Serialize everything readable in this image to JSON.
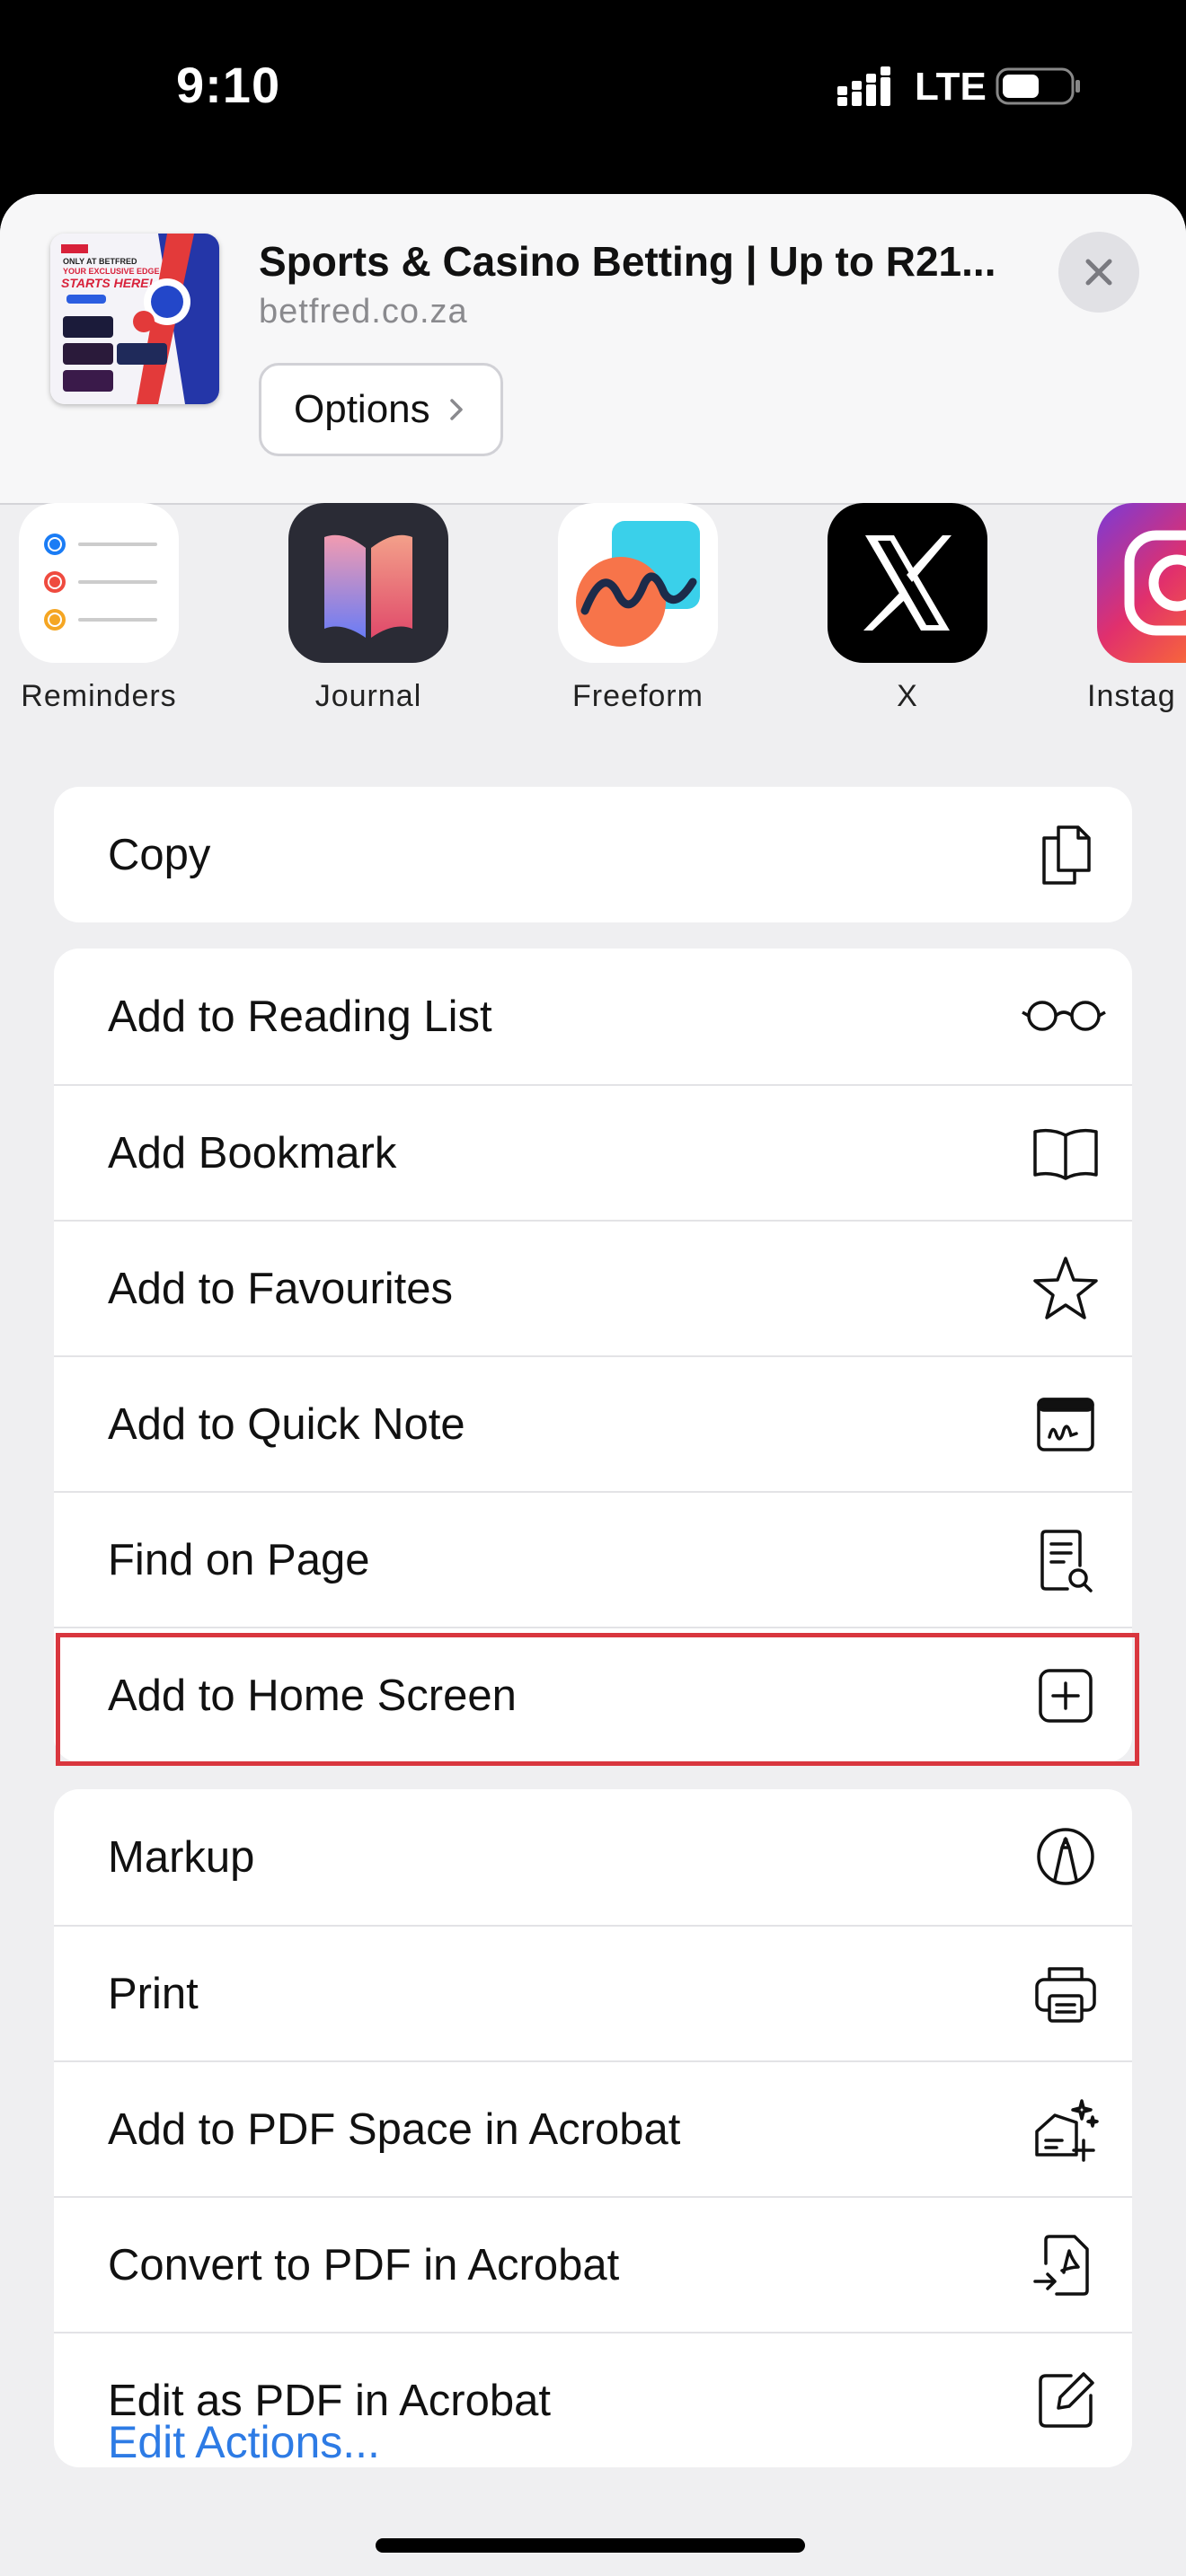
{
  "status_bar": {
    "time": "9:10",
    "network": "LTE"
  },
  "share_header": {
    "title": "Sports & Casino Betting | Up to R21...",
    "domain": "betfred.co.za",
    "options_label": "Options"
  },
  "thumbnail": {
    "line1": "ONLY AT BETFRED",
    "line2": "YOUR EXCLUSIVE EDGE",
    "line3": "STARTS HERE!"
  },
  "apps": [
    {
      "label": "Reminders",
      "icon": "reminders-icon"
    },
    {
      "label": "Journal",
      "icon": "journal-icon"
    },
    {
      "label": "Freeform",
      "icon": "freeform-icon"
    },
    {
      "label": "X",
      "icon": "x-icon"
    },
    {
      "label": "Instag",
      "icon": "instagram-icon"
    }
  ],
  "groups": [
    {
      "items": [
        {
          "label": "Copy",
          "icon": "copy-icon"
        }
      ]
    },
    {
      "items": [
        {
          "label": "Add to Reading List",
          "icon": "glasses-icon"
        },
        {
          "label": "Add Bookmark",
          "icon": "book-icon"
        },
        {
          "label": "Add to Favourites",
          "icon": "star-icon"
        },
        {
          "label": "Add to Quick Note",
          "icon": "quick-note-icon"
        },
        {
          "label": "Find on Page",
          "icon": "find-on-page-icon"
        },
        {
          "label": "Add to Home Screen",
          "icon": "plus-square-icon"
        }
      ]
    },
    {
      "items": [
        {
          "label": "Markup",
          "icon": "markup-icon"
        },
        {
          "label": "Print",
          "icon": "printer-icon"
        },
        {
          "label": "Add to PDF Space in Acrobat",
          "icon": "pdf-space-icon"
        },
        {
          "label": "Convert to PDF in Acrobat",
          "icon": "convert-pdf-icon"
        },
        {
          "label": "Edit as PDF in Acrobat",
          "icon": "edit-pdf-icon"
        }
      ]
    }
  ],
  "footer": {
    "edit_actions": "Edit Actions..."
  },
  "colors": {
    "highlight": "#d9363e",
    "link": "#2d7be5"
  }
}
